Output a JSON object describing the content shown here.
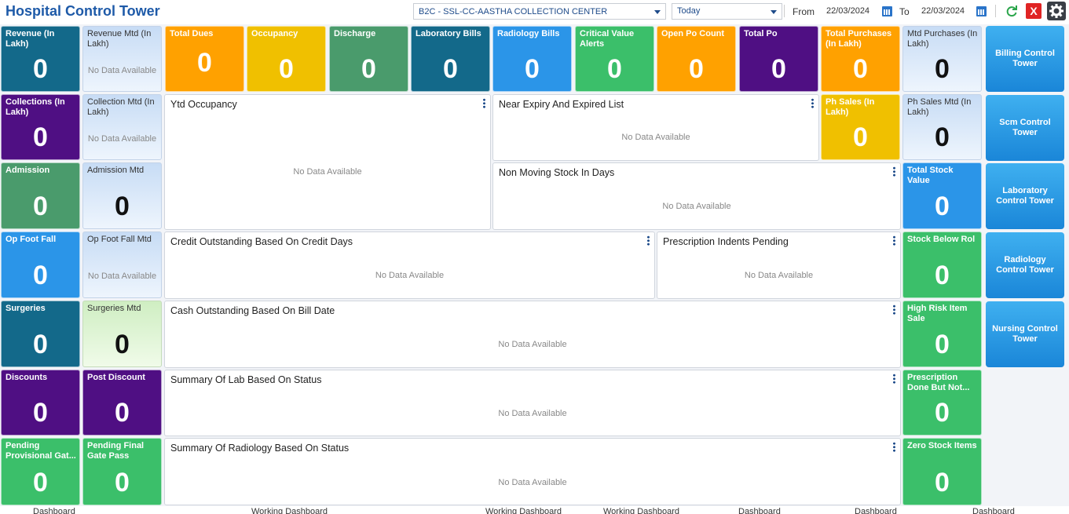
{
  "header": {
    "title": "Hospital Control Tower",
    "center_select": "B2C - SSL-CC-AASTHA COLLECTION CENTER",
    "period_select": "Today",
    "from_label": "From",
    "from_date": "22/03/2024",
    "to_label": "To",
    "to_date": "22/03/2024",
    "close_label": "X"
  },
  "no_data": "No Data Available",
  "tiles": {
    "revenue": {
      "label": "Revenue (In Lakh)",
      "value": "0",
      "color": "#13698a"
    },
    "revenue_mtd": {
      "label": "Revenue Mtd (In Lakh)"
    },
    "collections": {
      "label": "Collections (In Lakh)",
      "value": "0",
      "color": "#4f0f83"
    },
    "collection_mtd": {
      "label": "Collection Mtd (In Lakh)"
    },
    "admission": {
      "label": "Admission",
      "value": "0",
      "color": "#4a9b6c"
    },
    "admission_mtd": {
      "label": "Admission Mtd",
      "value": "0"
    },
    "op_foot_fall": {
      "label": "Op Foot Fall",
      "value": "0",
      "color": "#2b95e8"
    },
    "op_foot_fall_mtd": {
      "label": "Op Foot Fall Mtd"
    },
    "surgeries": {
      "label": "Surgeries",
      "value": "0",
      "color": "#13698a"
    },
    "surgeries_mtd": {
      "label": "Surgeries Mtd",
      "value": "0"
    },
    "discounts": {
      "label": "Discounts",
      "value": "0",
      "color": "#4f0f83"
    },
    "post_discount": {
      "label": "Post Discount",
      "value": "0",
      "color": "#4f0f83"
    },
    "pending_prov_gate": {
      "label": "Pending Provisional Gat...",
      "value": "0",
      "color": "#3bbf6a"
    },
    "pending_final_gate": {
      "label": "Pending Final Gate Pass",
      "value": "0",
      "color": "#3bbf6a"
    },
    "total_dues": {
      "label": "Total Dues",
      "value": "0",
      "color": "#ffa100"
    },
    "occupancy": {
      "label": "Occupancy",
      "value": "0",
      "color": "#f0c000"
    },
    "discharge": {
      "label": "Discharge",
      "value": "0",
      "color": "#4a9b6c"
    },
    "laboratory_bills": {
      "label": "Laboratory Bills",
      "value": "0",
      "color": "#13698a"
    },
    "radiology_bills": {
      "label": "Radiology Bills",
      "value": "0",
      "color": "#2b95e8"
    },
    "critical_value_alerts": {
      "label": "Critical Value Alerts",
      "value": "0",
      "color": "#3bbf6a"
    },
    "open_po_count": {
      "label": "Open Po Count",
      "value": "0",
      "color": "#ffa100"
    },
    "total_po": {
      "label": "Total Po",
      "value": "0",
      "color": "#4f0f83"
    },
    "total_purchases": {
      "label": "Total Purchases (In Lakh)",
      "value": "0",
      "color": "#ffa100"
    },
    "mtd_purchases": {
      "label": "Mtd Purchases (In Lakh)",
      "value": "0"
    },
    "ph_sales": {
      "label": "Ph Sales (In Lakh)",
      "value": "0",
      "color": "#f0c000"
    },
    "ph_sales_mtd": {
      "label": "Ph Sales Mtd (In Lakh)",
      "value": "0"
    },
    "total_stock_value": {
      "label": "Total Stock Value",
      "value": "0",
      "color": "#2b95e8"
    },
    "stock_below_rol": {
      "label": "Stock Below Rol",
      "value": "0",
      "color": "#3bbf6a"
    },
    "high_risk_item_sale": {
      "label": "High Risk Item Sale",
      "value": "0",
      "color": "#3bbf6a"
    },
    "prescription_done": {
      "label": "Prescription Done But Not...",
      "value": "0",
      "color": "#3bbf6a"
    },
    "zero_stock_items": {
      "label": "Zero Stock Items",
      "value": "0",
      "color": "#3bbf6a"
    }
  },
  "panels": {
    "ytd_occupancy": "Ytd Occupancy",
    "near_expiry": "Near Expiry And Expired List",
    "non_moving_stock": "Non Moving Stock In Days",
    "credit_outstanding": "Credit Outstanding Based On Credit Days",
    "prescription_indents": "Prescription Indents Pending",
    "cash_outstanding": "Cash Outstanding Based On Bill Date",
    "summary_lab": "Summary Of Lab Based On Status",
    "summary_radiology": "Summary Of Radiology Based On Status"
  },
  "control_towers": [
    "Billing Control Tower",
    "Scm Control Tower",
    "Laboratory Control Tower",
    "Radiology Control Tower",
    "Nursing Control Tower"
  ],
  "footer": [
    "Dashboard",
    "Working Dashboard",
    "Working Dashboard",
    "Working Dashboard",
    "Dashboard",
    "Dashboard",
    "Dashboard"
  ]
}
